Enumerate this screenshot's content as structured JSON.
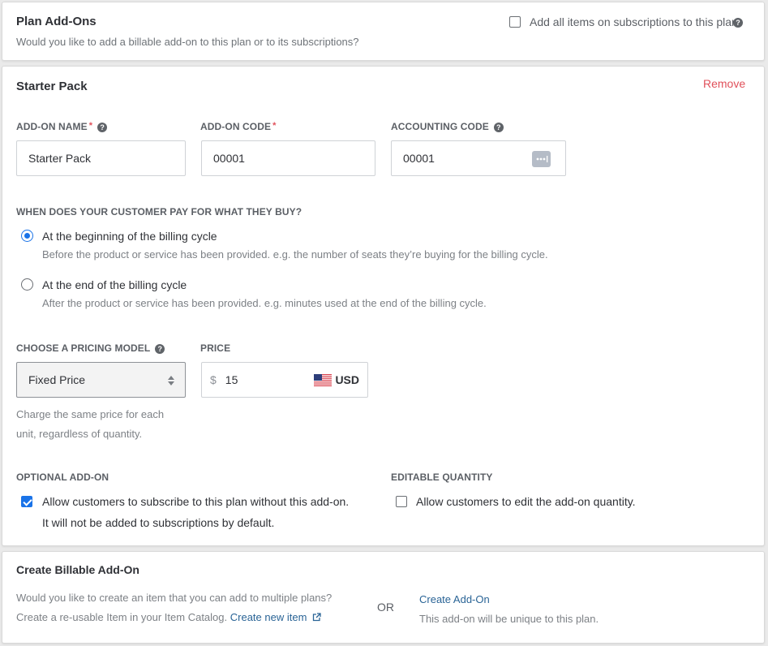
{
  "header": {
    "title": "Plan Add-Ons",
    "subtitle": "Would you like to add a billable add-on to this plan or to its subscriptions?",
    "add_all_label": "Add all items on subscriptions to this plan",
    "add_all_checked": false,
    "help_icon": "question-circle-icon"
  },
  "addon": {
    "title": "Starter Pack",
    "remove_label": "Remove",
    "fields": {
      "name": {
        "label": "ADD-ON NAME",
        "required": "*",
        "value": "Starter Pack"
      },
      "code": {
        "label": "ADD-ON CODE",
        "required": "*",
        "value": "00001"
      },
      "accounting": {
        "label": "ACCOUNTING CODE",
        "value": "00001",
        "action_icon": "more-dots-icon"
      }
    },
    "billing": {
      "question": "WHEN DOES YOUR CUSTOMER PAY FOR WHAT THEY BUY?",
      "options": [
        {
          "title": "At the beginning of the billing cycle",
          "desc": "Before the product or service has been provided. e.g. the number of seats they’re buying for the billing cycle.",
          "selected": true
        },
        {
          "title": "At the end of the billing cycle",
          "desc": "After the product or service has been provided. e.g. minutes used at the end of the billing cycle.",
          "selected": false
        }
      ]
    },
    "pricing": {
      "model_label": "CHOOSE A PRICING MODEL",
      "model_value": "Fixed Price",
      "model_desc_line1": "Charge the same price for each",
      "model_desc_line2": "unit, regardless of quantity.",
      "price_label": "PRICE",
      "currency_symbol": "$",
      "price_value": "15",
      "currency_code": "USD",
      "flag_icon": "us-flag-icon"
    },
    "optional": {
      "label": "OPTIONAL ADD-ON",
      "checked": true,
      "text_line1": "Allow customers to subscribe to this plan without this add-on.",
      "text_line2": "It will not be added to subscriptions by default."
    },
    "editable": {
      "label": "EDITABLE QUANTITY",
      "checked": false,
      "text": "Allow customers to edit the add-on quantity."
    }
  },
  "create": {
    "title": "Create Billable Add-On",
    "left_line1": "Would you like to create an item that you can add to multiple plans?",
    "left_line2": "Create a re-usable Item in your Item Catalog.",
    "create_item_link": "Create new item",
    "or_label": "OR",
    "create_addon_link": "Create Add-On",
    "create_addon_desc": "This add-on will be unique to this plan."
  },
  "colors": {
    "accent_blue": "#1a73e8",
    "link_blue": "#2a6496",
    "danger_red": "#e0505a"
  }
}
